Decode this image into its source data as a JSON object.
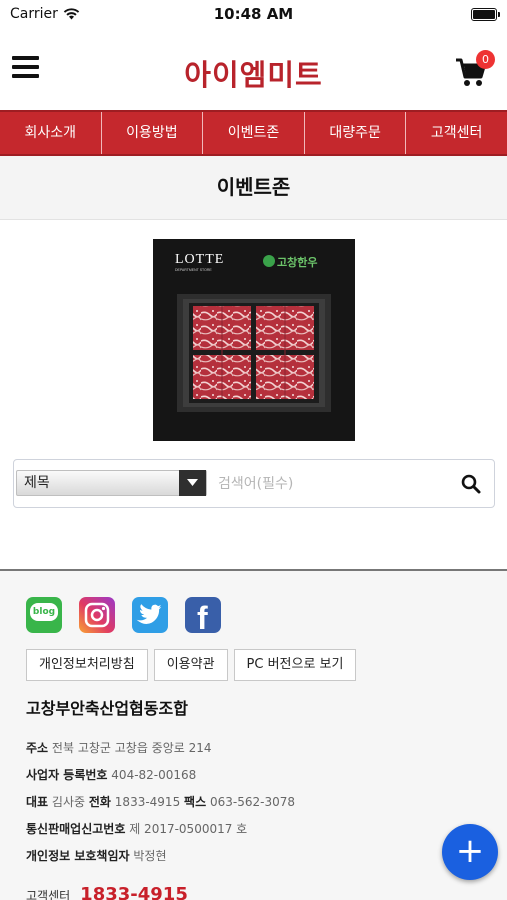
{
  "status_bar": {
    "carrier": "Carrier",
    "time": "10:48 AM",
    "battery_level": 1.0
  },
  "header": {
    "brand": "아이엠미트",
    "cart_count": "0"
  },
  "nav": {
    "items": [
      "회사소개",
      "이용방법",
      "이벤트존",
      "대량주문",
      "고객센터"
    ]
  },
  "page": {
    "title": "이벤트존"
  },
  "event_image": {
    "brand_text": "LOTTE",
    "brand_sub": "DEPARTMENT STORE",
    "logo_text": "고창한우"
  },
  "search": {
    "select_value": "제목",
    "placeholder": "검색어(필수)"
  },
  "footer": {
    "social": [
      "blog-icon",
      "instagram-icon",
      "twitter-icon",
      "facebook-icon"
    ],
    "blog_label": "blog",
    "links": [
      "개인정보처리방침",
      "이용약관",
      "PC 버전으로 보기"
    ],
    "company_name": "고창부안축산업협동조합",
    "address_label": "주소",
    "address": "전북 고창군 고창읍 중앙로 214",
    "biz_label": "사업자 등록번호",
    "biz_number": "404-82-00168",
    "ceo_label": "대표",
    "ceo": "김사중",
    "phone_label": "전화",
    "phone": "1833-4915",
    "fax_label": "팩스",
    "fax": "063-562-3078",
    "ecommerce_label": "통신판매업신고번호",
    "ecommerce": "제 2017-0500017 호",
    "privacy_label": "개인정보 보호책임자",
    "privacy_officer": "박정현",
    "cs_label": "고객센터",
    "cs_number": "1833-4915"
  },
  "fab": {
    "label": "+"
  },
  "colors": {
    "brand": "#b8232b",
    "nav_bg": "#c5282d",
    "fab": "#1a60e0",
    "cs_number": "#c8202a"
  }
}
